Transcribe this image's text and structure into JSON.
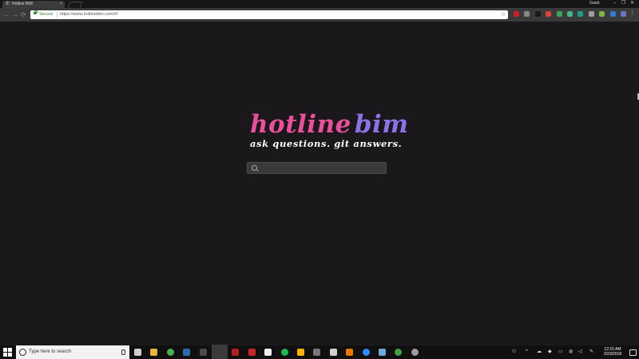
{
  "browser": {
    "tab_title": "Hotline BIM",
    "tab_close": "×",
    "profile_name": "Grant",
    "window_controls": [
      "–",
      "❐",
      "✕"
    ],
    "nav": {
      "back": "←",
      "forward": "→",
      "reload": "⟳"
    },
    "address": {
      "secure_label": "Secure",
      "url": "https://www.hotlinebim.com/#/"
    },
    "extensions": [
      {
        "name": "pinterest-ext-icon",
        "color": "#c8232c"
      },
      {
        "name": "mail-ext-icon",
        "color": "#888888"
      },
      {
        "name": "onepassword-ext-icon",
        "color": "#1a1a1a"
      },
      {
        "name": "red-ext-icon",
        "color": "#d9443a"
      },
      {
        "name": "green-shield-ext-icon",
        "color": "#3aa757"
      },
      {
        "name": "vue-ext-icon",
        "color": "#41b883"
      },
      {
        "name": "teal-ext-icon",
        "color": "#16a085"
      },
      {
        "name": "gray-ext-icon",
        "color": "#9e9e9e"
      },
      {
        "name": "green-ext-icon",
        "color": "#7cb342"
      },
      {
        "name": "blue-ext-icon",
        "color": "#2f7bd6"
      },
      {
        "name": "purple-ext-icon",
        "color": "#6c74c8"
      }
    ]
  },
  "page": {
    "logo_word1": "hotline",
    "logo_word2": "bim",
    "tagline": "ask questions. git answers.",
    "search_placeholder": "",
    "colors": {
      "pink": "#ea4f9c",
      "purple": "#8b72e6",
      "background": "#1a181b"
    }
  },
  "taskbar": {
    "search_placeholder": "Type here to search",
    "apps": [
      {
        "name": "task-view-icon",
        "color": "#cfcfcf"
      },
      {
        "name": "file-explorer-icon",
        "color": "#e8b53a"
      },
      {
        "name": "chrome-icon",
        "color": "#4caf50"
      },
      {
        "name": "revit-icon",
        "color": "#2b6cb0"
      },
      {
        "name": "sublime-icon",
        "color": "#4a4a4a"
      },
      {
        "name": "chrome-active-icon",
        "color": "#e0e0e0"
      },
      {
        "name": "app-b-icon",
        "color": "#b71c1c"
      },
      {
        "name": "app-red-icon",
        "color": "#c62828"
      },
      {
        "name": "app-white-icon",
        "color": "#eeeeee"
      },
      {
        "name": "spotify-icon",
        "color": "#1db954"
      },
      {
        "name": "play-icon",
        "color": "#ffb300"
      },
      {
        "name": "app-gray-icon",
        "color": "#777777"
      },
      {
        "name": "settings-icon",
        "color": "#cfcfcf"
      },
      {
        "name": "blender-icon",
        "color": "#ea7600"
      },
      {
        "name": "zoom-icon",
        "color": "#2d8cff"
      },
      {
        "name": "app-blue-icon",
        "color": "#6fa8dc"
      },
      {
        "name": "green-gear-icon",
        "color": "#43a047"
      },
      {
        "name": "app-circle-icon",
        "color": "#9e9e9e"
      }
    ],
    "tray": {
      "chevron": "^",
      "time": "12:15 AM",
      "date": "2/23/2018"
    }
  }
}
